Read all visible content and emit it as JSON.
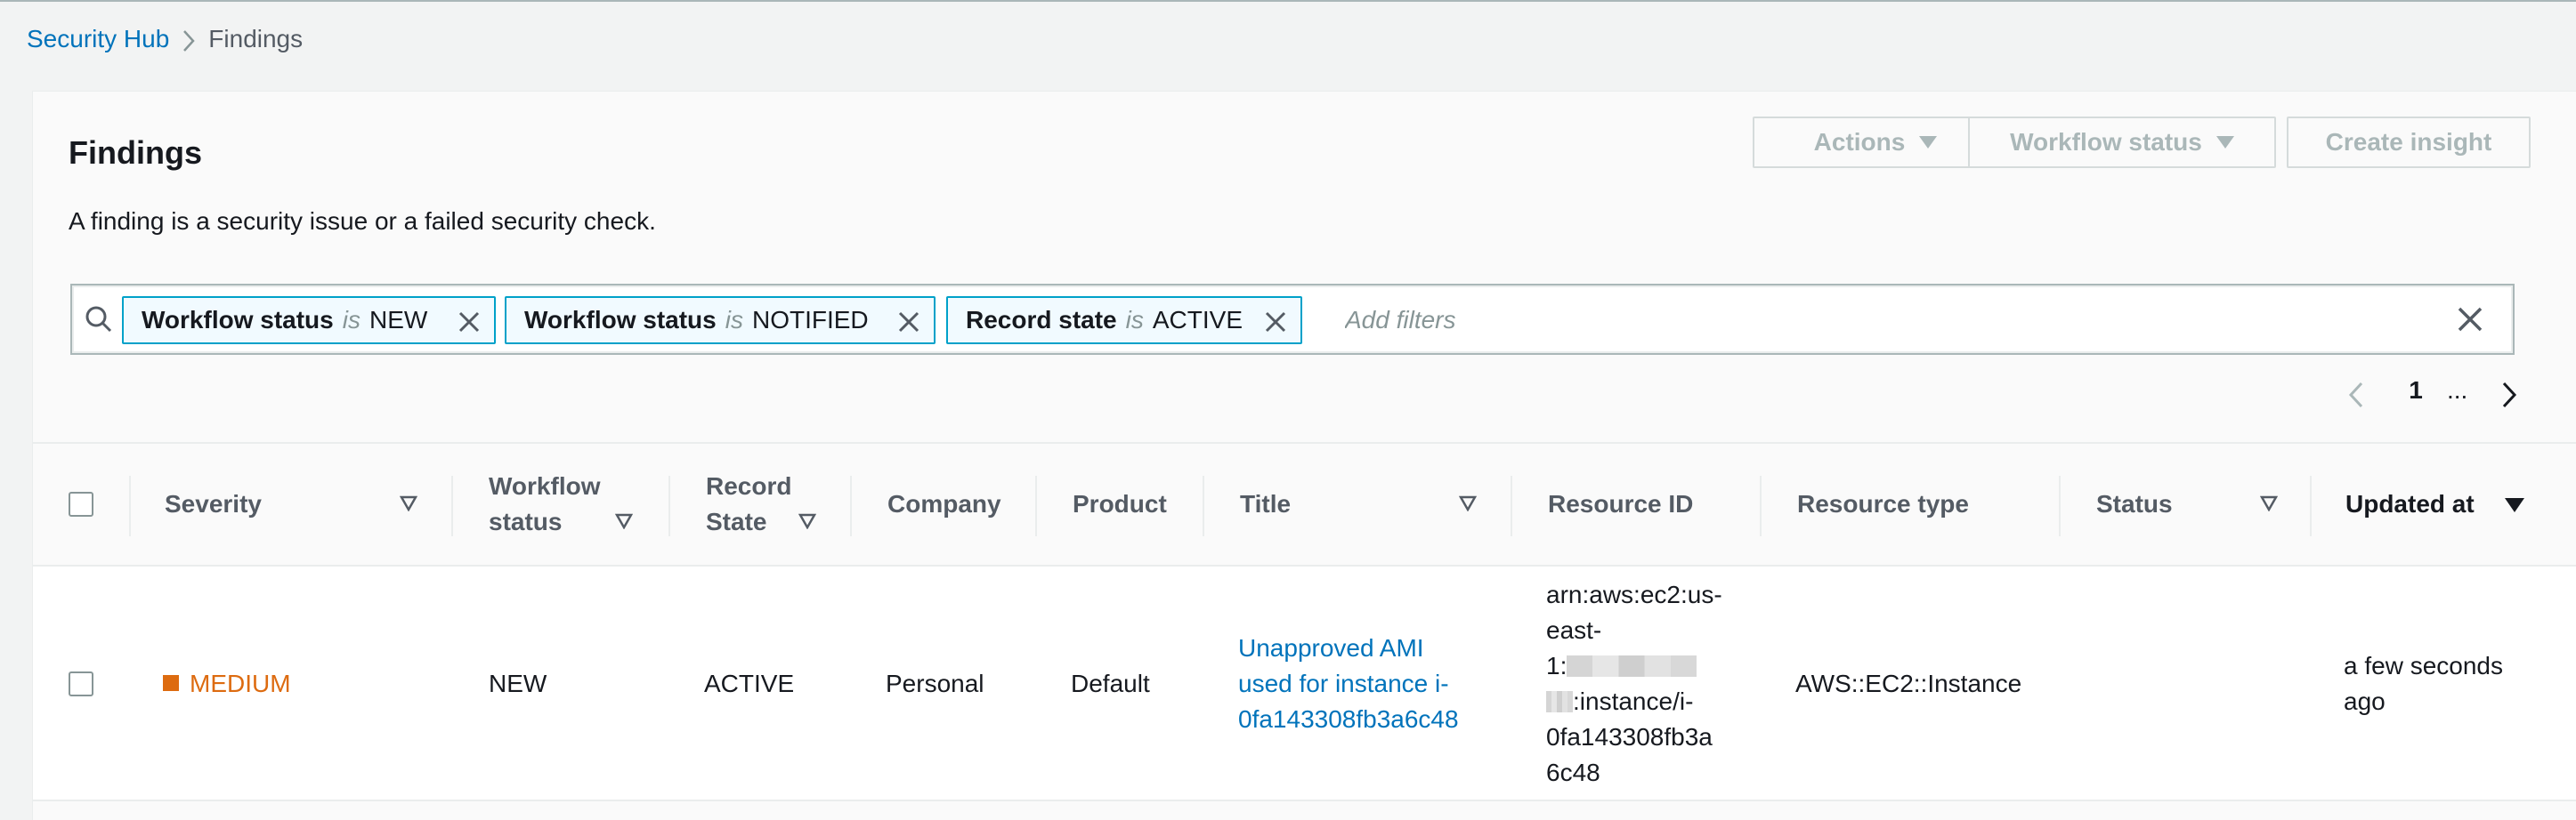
{
  "breadcrumb": {
    "root": "Security Hub",
    "current": "Findings"
  },
  "panel": {
    "title": "Findings",
    "description": "A finding is a security issue or a failed security check.",
    "buttons": {
      "actions": "Actions",
      "workflow_status": "Workflow status",
      "create_insight": "Create insight"
    }
  },
  "filters": {
    "tokens": [
      {
        "key": "Workflow status",
        "op": "is",
        "value": "NEW"
      },
      {
        "key": "Workflow status",
        "op": "is",
        "value": "NOTIFIED"
      },
      {
        "key": "Record state",
        "op": "is",
        "value": "ACTIVE"
      }
    ],
    "placeholder": "Add filters"
  },
  "pagination": {
    "current_page": "1",
    "ellipsis": "..."
  },
  "table": {
    "columns": [
      {
        "label": "Severity"
      },
      {
        "label_line1": "Workflow",
        "label_line2": "status"
      },
      {
        "label_line1": "Record",
        "label_line2": "State"
      },
      {
        "label": "Company"
      },
      {
        "label": "Product"
      },
      {
        "label": "Title"
      },
      {
        "label": "Resource ID"
      },
      {
        "label": "Resource type"
      },
      {
        "label": "Status"
      },
      {
        "label": "Updated at"
      }
    ],
    "rows": [
      {
        "severity": "MEDIUM",
        "workflow_status": "NEW",
        "record_state": "ACTIVE",
        "company": "Personal",
        "product": "Default",
        "title_line1": "Unapproved AMI",
        "title_line2": "used for instance i-",
        "title_line3": "0fa143308fb3a6c48",
        "resource_id_line1": "arn:aws:ec2:us-",
        "resource_id_line2": "east-",
        "resource_id_line3": "1:",
        "resource_id_line4": ":instance/i-",
        "resource_id_line5": "0fa143308fb3a",
        "resource_id_line6": "6c48",
        "resource_type": "AWS::EC2::Instance",
        "status": "",
        "updated_at_line1": "a few seconds",
        "updated_at_line2": "ago"
      }
    ]
  },
  "colors": {
    "link": "#0073bb",
    "severity_medium": "#dd6b10",
    "token_border": "#00a1c9",
    "disabled_text": "#aab7b8"
  }
}
